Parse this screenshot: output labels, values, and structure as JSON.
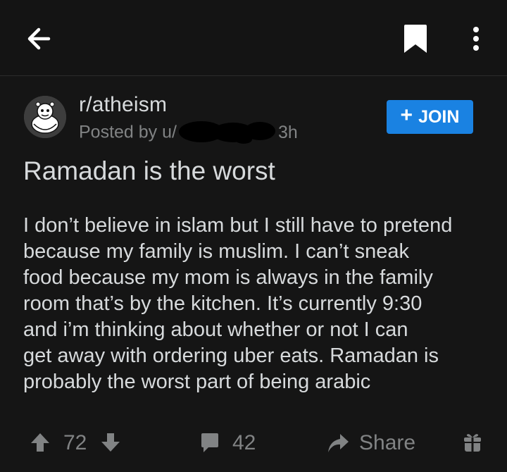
{
  "toolbar": {
    "back_icon": "arrow-left-icon",
    "bookmark_icon": "bookmark-icon",
    "more_icon": "more-vertical-icon"
  },
  "post": {
    "subreddit": "r/atheism",
    "posted_by_prefix": "Posted by u/",
    "age": "3h",
    "join_label": "JOIN",
    "title": "Ramadan is the worst",
    "body_lines": [
      "I don’t believe in islam but I still have to pretend",
      "because my family is muslim. I can’t sneak",
      "food because my mom is always in the family",
      "room that’s by the kitchen. It’s currently 9:30",
      "and i’m thinking about whether or not I can",
      "get away with ordering uber eats. Ramadan is",
      "probably the worst part of being arabic"
    ]
  },
  "actions": {
    "vote_count": "72",
    "comment_count": "42",
    "share_label": "Share",
    "award_icon": "gift-icon"
  },
  "colors": {
    "background": "#151515",
    "text": "#d7dadc",
    "muted": "#818384",
    "join_button": "#1a82e2"
  }
}
